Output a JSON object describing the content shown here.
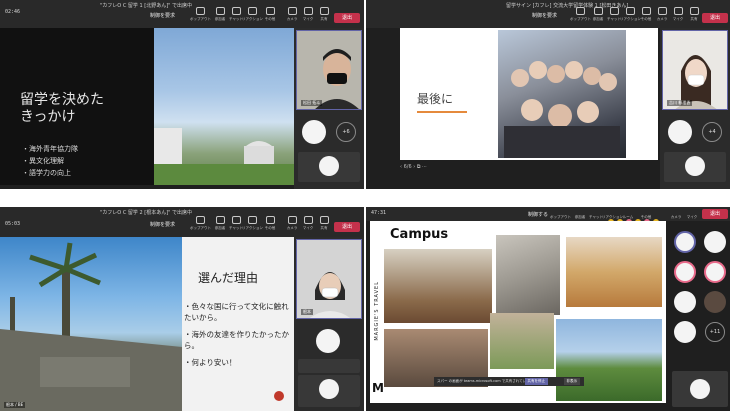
{
  "panels": [
    {
      "timer": "02:46",
      "title": "\"カフレO C 留学 1 [北野あん]\" で出席中",
      "controls": [
        "ポップアウト",
        "参加者",
        "チャット",
        "リアクション",
        "その他",
        "カメラ",
        "マイク",
        "共有"
      ],
      "request_label": "制御を要求",
      "leave_label": "退出",
      "slide": {
        "heading": [
          "留学を決めた",
          "きっかけ"
        ],
        "bullets": [
          "・海外青年協力隊",
          "・異文化理解",
          "・語学力の向上"
        ]
      },
      "video_name": "松田 拓斗",
      "participant_count": "+6"
    },
    {
      "title": "留学サイン [カフレ] 交流大学留学体験 1 [松田きあん]",
      "controls": [
        "ポップアウト",
        "参加者",
        "チャット",
        "リアクション",
        "その他",
        "カメラ",
        "マイク",
        "共有"
      ],
      "request_label": "制御を要求",
      "leave_label": "退出",
      "slide": {
        "heading": "最後に"
      },
      "page_indicator": "6/6",
      "video_name": "吉川 楓理香",
      "participant_count": "+4"
    },
    {
      "timer": "05:03",
      "title": "\"カフレO C 留学 2 [根本あん]\" で出席中",
      "controls": [
        "ポップアウト",
        "参加者",
        "チャット",
        "リアクション",
        "その他",
        "カメラ",
        "マイク",
        "共有"
      ],
      "request_label": "制御を要求",
      "leave_label": "退出",
      "slide": {
        "heading": "選んだ理由",
        "bullets": [
          "・色々な国に行って文化に触れたいから。",
          "・海外の友達を作りたかったから。",
          "・何より安い！"
        ]
      },
      "video_name": "根本",
      "photo_caption": "根本 / BE"
    },
    {
      "timer": "47:31",
      "controls": [
        "ポップアウト",
        "参加者",
        "チャット",
        "リアクション",
        "ルーム",
        "その他",
        "カメラ",
        "マイク"
      ],
      "request_label": "制御する",
      "leave_label": "退出",
      "slide": {
        "heading": "Campus",
        "side_text": "MARGIE'S TRAVEL",
        "logo": "M"
      },
      "toast": {
        "text": "スパー の画面が teams.microsoft.com で共有されています。",
        "primary": "共有を停止",
        "secondary": "非表示"
      },
      "participant_count": "+11",
      "reaction_colors": [
        "#e6b422",
        "#e6b422",
        "#e86a8a",
        "#e6b422",
        "#e86a8a",
        "#e6b422"
      ]
    }
  ]
}
